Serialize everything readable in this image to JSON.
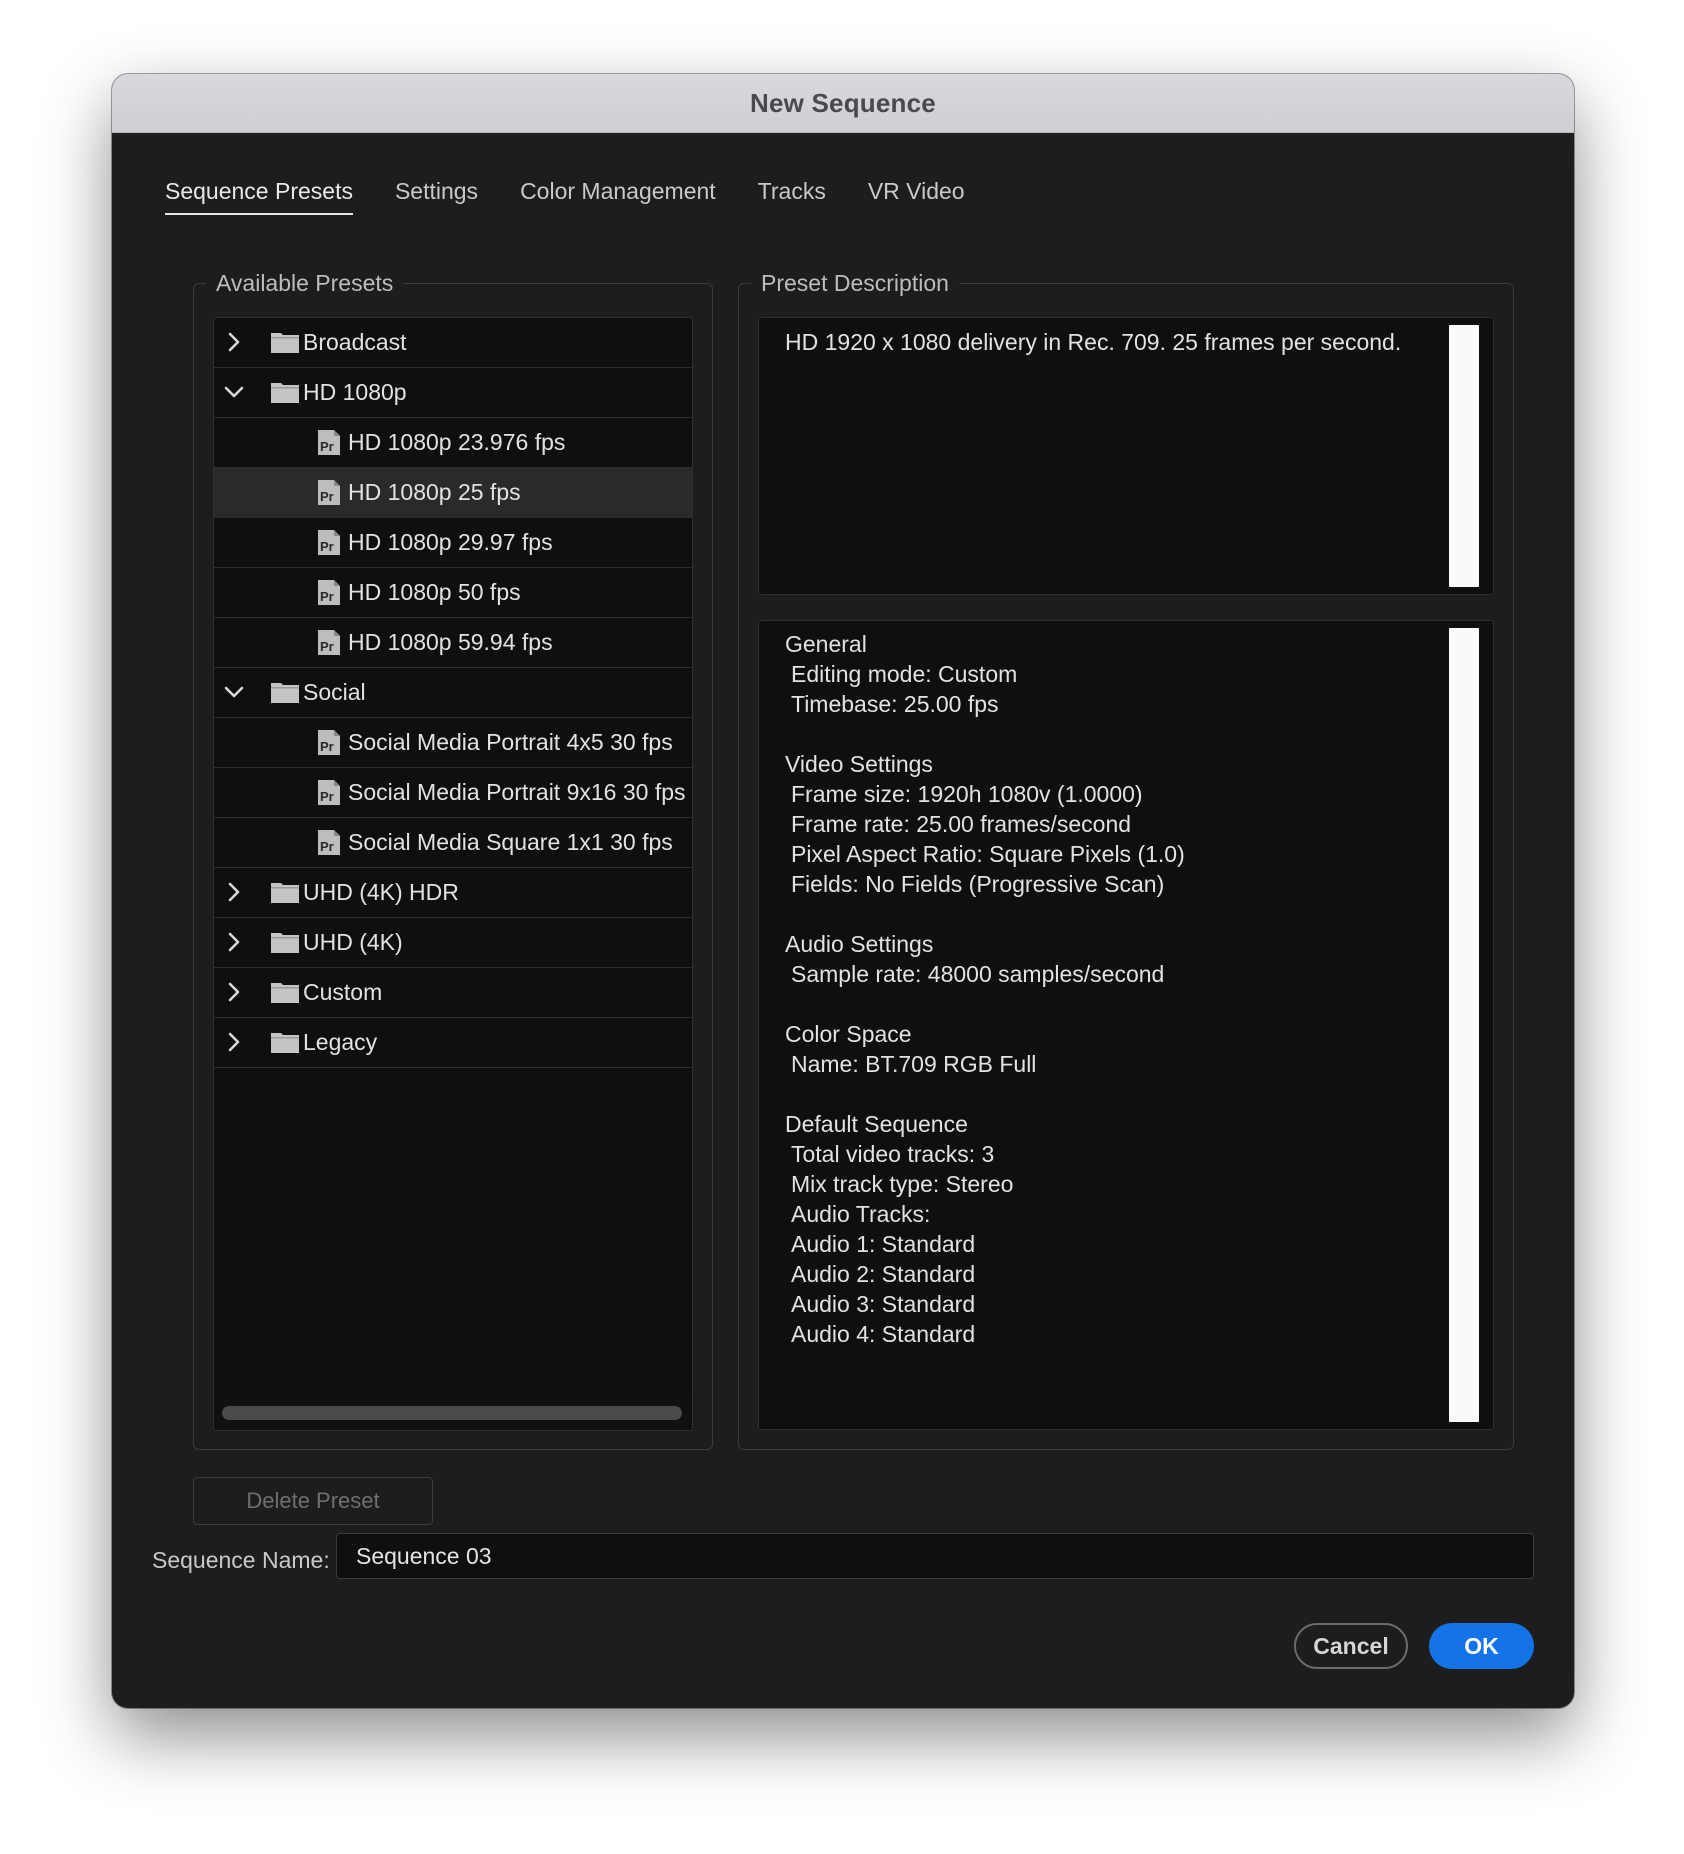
{
  "dialog": {
    "title": "New Sequence"
  },
  "tabs": [
    {
      "label": "Sequence Presets",
      "active": true
    },
    {
      "label": "Settings",
      "active": false
    },
    {
      "label": "Color Management",
      "active": false
    },
    {
      "label": "Tracks",
      "active": false
    },
    {
      "label": "VR Video",
      "active": false
    }
  ],
  "presets": {
    "legend": "Available Presets",
    "items": [
      {
        "type": "folder",
        "label": "Broadcast",
        "expanded": false,
        "icon": "folder-icon"
      },
      {
        "type": "folder",
        "label": "HD 1080p",
        "expanded": true,
        "icon": "folder-icon"
      },
      {
        "type": "preset",
        "label": "HD 1080p 23.976 fps",
        "icon": "premiere-preset-icon"
      },
      {
        "type": "preset",
        "label": "HD 1080p 25 fps",
        "selected": true,
        "icon": "premiere-preset-icon"
      },
      {
        "type": "preset",
        "label": "HD 1080p 29.97 fps",
        "icon": "premiere-preset-icon"
      },
      {
        "type": "preset",
        "label": "HD 1080p 50 fps",
        "icon": "premiere-preset-icon"
      },
      {
        "type": "preset",
        "label": "HD 1080p 59.94 fps",
        "icon": "premiere-preset-icon"
      },
      {
        "type": "folder",
        "label": "Social",
        "expanded": true,
        "icon": "folder-icon"
      },
      {
        "type": "preset",
        "label": "Social Media Portrait 4x5 30 fps",
        "icon": "premiere-preset-icon"
      },
      {
        "type": "preset",
        "label": "Social Media Portrait 9x16 30 fps",
        "icon": "premiere-preset-icon"
      },
      {
        "type": "preset",
        "label": "Social Media Square 1x1 30 fps",
        "icon": "premiere-preset-icon"
      },
      {
        "type": "folder",
        "label": "UHD (4K) HDR",
        "expanded": false,
        "icon": "folder-icon"
      },
      {
        "type": "folder",
        "label": "UHD (4K)",
        "expanded": false,
        "icon": "folder-icon"
      },
      {
        "type": "folder",
        "label": "Custom",
        "expanded": false,
        "icon": "folder-icon"
      },
      {
        "type": "folder",
        "label": "Legacy",
        "expanded": false,
        "icon": "folder-icon"
      }
    ]
  },
  "description": {
    "legend": "Preset Description",
    "summary": "HD 1920 x 1080 delivery in Rec. 709. 25 frames per second.",
    "sections": [
      {
        "heading": "General",
        "lines": [
          "Editing mode: Custom",
          "Timebase: 25.00 fps"
        ]
      },
      {
        "heading": "Video Settings",
        "lines": [
          "Frame size: 1920h 1080v (1.0000)",
          "Frame rate: 25.00  frames/second",
          "Pixel Aspect Ratio: Square Pixels (1.0)",
          "Fields: No Fields (Progressive Scan)"
        ]
      },
      {
        "heading": "Audio Settings",
        "lines": [
          "Sample rate: 48000 samples/second"
        ]
      },
      {
        "heading": "Color Space",
        "lines": [
          "Name: BT.709 RGB Full"
        ]
      },
      {
        "heading": "Default Sequence",
        "lines": [
          "Total video tracks: 3",
          "Mix track type: Stereo",
          "Audio Tracks:",
          "Audio 1: Standard",
          "Audio 2: Standard",
          "Audio 3: Standard",
          "Audio 4: Standard"
        ]
      }
    ]
  },
  "buttons": {
    "delete_preset": "Delete Preset",
    "cancel": "Cancel",
    "ok": "OK"
  },
  "sequence_name": {
    "label": "Sequence Name:",
    "value": "Sequence 03"
  },
  "colors": {
    "dialog_bg": "#1d1d1d",
    "panel_bg": "#0f0f0f",
    "accent_blue": "#1473e6",
    "selected_row": "#2a2a2a"
  }
}
